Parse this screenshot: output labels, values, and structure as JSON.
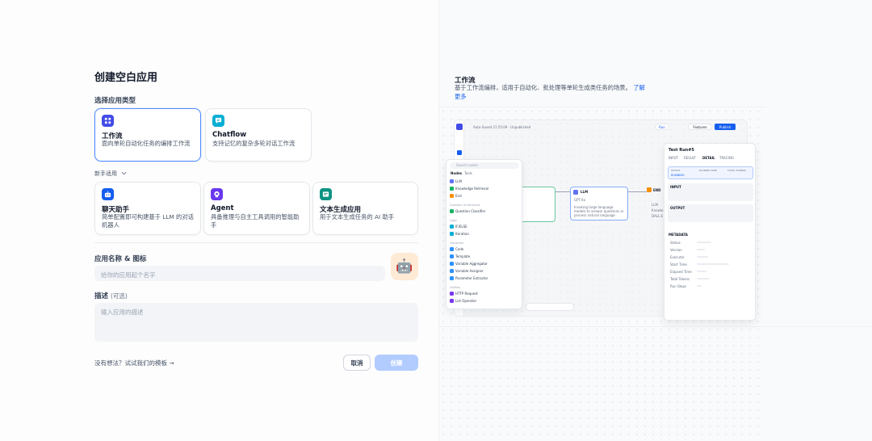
{
  "dialog": {
    "title": "创建空白应用",
    "app_type_label": "选择应用类型",
    "beginner_label": "新手适用",
    "name_label": "应用名称 & 图标",
    "name_placeholder": "给你的应用起个名字",
    "desc_label": "描述",
    "desc_optional": "(可选)",
    "desc_placeholder": "输入应用的描述",
    "template_link": "没有想法？试试我们的模板 →",
    "cancel": "取消",
    "create": "创建"
  },
  "app_types": [
    {
      "title": "工作流",
      "desc": "面向单轮自动化任务的编排工作流",
      "icon": "workflow-icon",
      "color": "#444ce7",
      "selected": true
    },
    {
      "title": "Chatflow",
      "desc": "支持记忆的复杂多轮对话工作流",
      "icon": "chatflow-icon",
      "color": "#06aed4",
      "selected": false
    }
  ],
  "beginner_types": [
    {
      "title": "聊天助手",
      "desc": "简单配置即可构建基于 LLM 的对话机器人",
      "icon": "chat-bot-icon",
      "color": "#155eef"
    },
    {
      "title": "Agent",
      "desc": "具备推理与自主工具调用的智能助手",
      "icon": "agent-icon",
      "color": "#6938ef"
    },
    {
      "title": "文本生成应用",
      "desc": "用于文本生成任务的 AI 助手",
      "icon": "text-gen-icon",
      "color": "#0e9384"
    }
  ],
  "avatar": {
    "emoji": "🤖",
    "bg": "#ffead5"
  },
  "preview": {
    "title": "工作流",
    "desc": "基于工作流编排，适用于自动化、批处理等单轮生成类任务的场景。",
    "more": "了解更多",
    "mini": {
      "autosave": "Auto-Saved 21:55:09 · Unpublished",
      "run": "Run",
      "features": "Features",
      "publish": "Publish",
      "search": "Search nodes",
      "tabs": [
        "Nodes",
        "Tools"
      ],
      "nodes": [
        "LLM",
        "Knowledge Retrieval",
        "End"
      ],
      "sec_qu": "Question Understand",
      "qu": [
        "Question Classifier"
      ],
      "sec_logic": "Logic",
      "logic": [
        "IF/ELSE",
        "Iteration"
      ],
      "sec_trans": "Transform",
      "trans": [
        "Code",
        "Template",
        "Variable Aggregator",
        "Variable Assigner",
        "Parameter Extractor"
      ],
      "sec_util": "Utilities",
      "util": [
        "HTTP Request",
        "List Operator"
      ],
      "llm_node": "LLM",
      "llm_model": "GPT-4o",
      "llm_desc": "Invoking large language models to answer questions or process natural language",
      "end_node": "END",
      "end_vars": [
        "LLM",
        "Knowle",
        "DALL·E"
      ],
      "run_title": "Test Run#5",
      "run_tabs": [
        "INPUT",
        "RESULT",
        "DETAIL",
        "TRACING"
      ],
      "status": [
        "STATUS",
        "ELAPSED TIME",
        "TOTAL TOKENS"
      ],
      "status_val": "RUNNING",
      "input": "INPUT",
      "output": "OUTPUT",
      "metadata": "METADATA",
      "meta_rows": [
        "Status",
        "Version",
        "Executor",
        "Start Time",
        "Elapsed Time",
        "Total Tokens",
        "Run Steps"
      ]
    }
  }
}
